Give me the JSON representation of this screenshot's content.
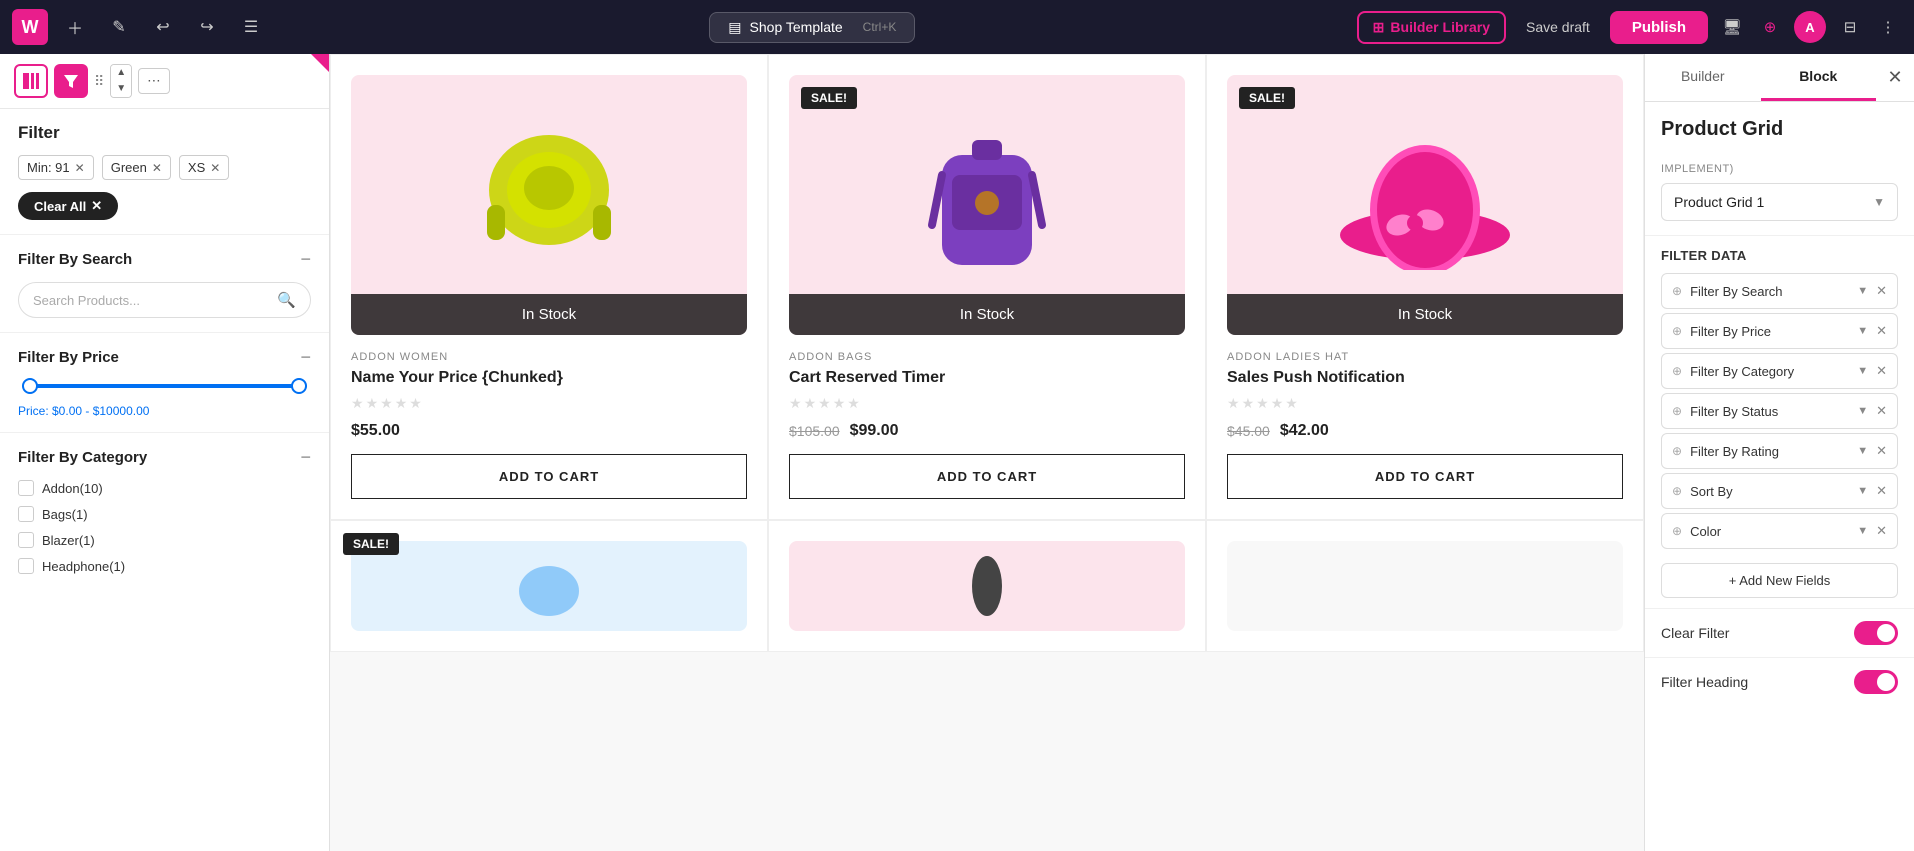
{
  "topbar": {
    "logo": "W",
    "builder_library": "Builder Library",
    "save_draft": "Save draft",
    "publish": "Publish",
    "template_name": "Shop Template",
    "shortcut": "Ctrl+K",
    "avatar": "A"
  },
  "left_panel": {
    "filter_heading": "Filter",
    "active_tags": [
      {
        "label": "Min: 91",
        "id": "min91"
      },
      {
        "label": "Green",
        "id": "green"
      },
      {
        "label": "XS",
        "id": "xs"
      }
    ],
    "clear_all": "Clear All",
    "filter_by_search": {
      "heading": "Filter By Search",
      "placeholder": "Search Products..."
    },
    "filter_by_price": {
      "heading": "Filter By Price",
      "price_label": "Price: $0.00 - $10000.00"
    },
    "filter_by_category": {
      "heading": "Filter By Category",
      "items": [
        {
          "label": "Addon(10)"
        },
        {
          "label": "Bags(1)"
        },
        {
          "label": "Blazer(1)"
        },
        {
          "label": "Headphone(1)"
        }
      ]
    }
  },
  "products": [
    {
      "id": 1,
      "category": "ADDON  WOMEN",
      "name": "Name Your Price {Chunked}",
      "price_current": "$55.00",
      "price_original": null,
      "sale": false,
      "in_stock": true,
      "rating": 0,
      "add_to_cart": "ADD TO CART",
      "bg_color": "#fce4ec"
    },
    {
      "id": 2,
      "category": "ADDON  BAGS",
      "name": "Cart Reserved Timer",
      "price_current": "$99.00",
      "price_original": "$105.00",
      "sale": true,
      "in_stock": true,
      "rating": 0,
      "add_to_cart": "ADD TO CART",
      "bg_color": "#fce4ec"
    },
    {
      "id": 3,
      "category": "ADDON  LADIES HAT",
      "name": "Sales Push Notification",
      "price_current": "$42.00",
      "price_original": "$45.00",
      "sale": true,
      "in_stock": true,
      "rating": 0,
      "add_to_cart": "ADD TO CART",
      "bg_color": "#fce4ec"
    }
  ],
  "bottom_products": [
    {
      "id": 4,
      "sale": true
    },
    {
      "id": 5,
      "sale": false
    },
    {
      "id": 6,
      "sale": false
    }
  ],
  "right_panel": {
    "tab_builder": "Builder",
    "tab_block": "Block",
    "implement_label": "IMPLEMENT)",
    "implement_value": "Product Grid 1",
    "filter_data_label": "FILTER DATA",
    "filter_rows": [
      {
        "label": "Filter By Search",
        "id": "filter-search"
      },
      {
        "label": "Filter By Price",
        "id": "filter-price"
      },
      {
        "label": "Filter By Category",
        "id": "filter-category"
      },
      {
        "label": "Filter By Status",
        "id": "filter-status"
      },
      {
        "label": "Filter By Rating",
        "id": "filter-rating"
      },
      {
        "label": "Sort By",
        "id": "sort-by"
      },
      {
        "label": "Color",
        "id": "color"
      }
    ],
    "add_new_fields": "+ Add New Fields",
    "clear_filter_label": "Clear Filter",
    "filter_heading_label": "Filter Heading",
    "product_grid_title": "Product Grid"
  },
  "in_stock_label": "In Stock",
  "sale_badge": "SALE!"
}
